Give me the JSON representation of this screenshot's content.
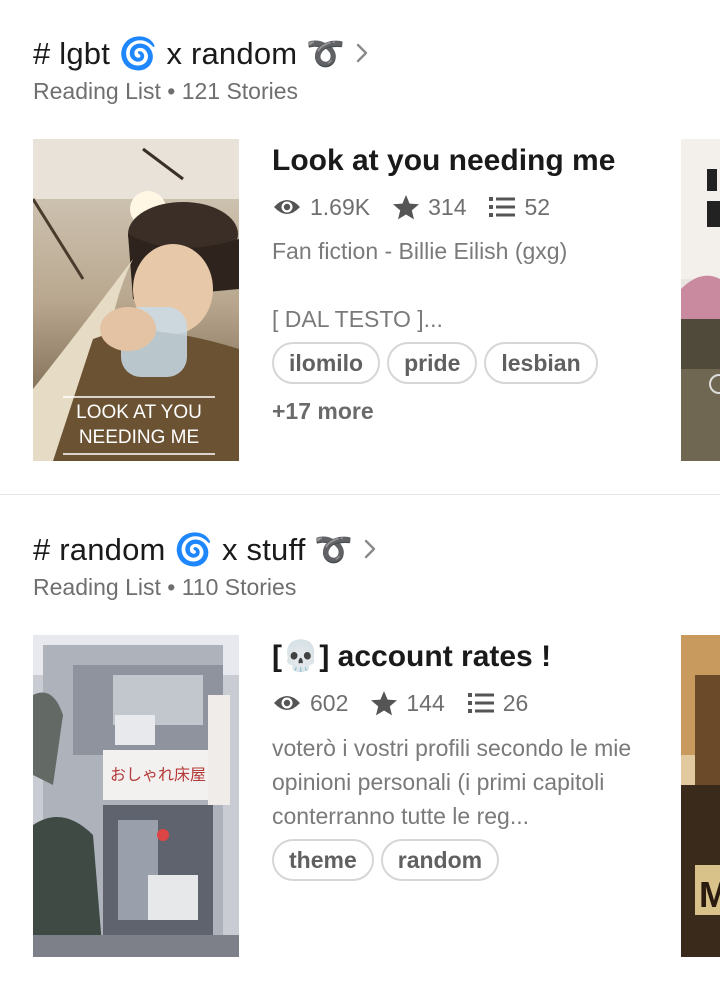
{
  "lists": [
    {
      "title": "# lgbt 🌀 x random ➰",
      "meta": "Reading List • 121 Stories",
      "story": {
        "title": "Look at you needing me",
        "reads": "1.69K",
        "votes": "314",
        "parts": "52",
        "category": "Fan fiction - Billie Eilish (gxg)",
        "description": "[ DAL TESTO ]...",
        "tags": [
          "ilomilo",
          "pride",
          "lesbian"
        ],
        "more_tags": "+17 more",
        "cover_text": [
          "LOOK AT YOU",
          "NEEDING ME"
        ]
      }
    },
    {
      "title": "# random 🌀 x stuff ➰",
      "meta": "Reading List • 110 Stories",
      "story": {
        "title": "[💀] account rates !",
        "reads": "602",
        "votes": "144",
        "parts": "26",
        "description": "voterò i vostri profili secondo le mie opinioni personali (i primi capitoli conterranno tutte le reg...",
        "tags": [
          "theme",
          "random"
        ]
      }
    }
  ],
  "colors": {
    "text": "#1a1a1a",
    "muted": "#6f6f6f",
    "tag_border": "#d6d6d6"
  },
  "icons": {
    "reads": "eye-icon",
    "votes": "star-icon",
    "parts": "list-icon",
    "nav": "chevron-right-icon"
  }
}
